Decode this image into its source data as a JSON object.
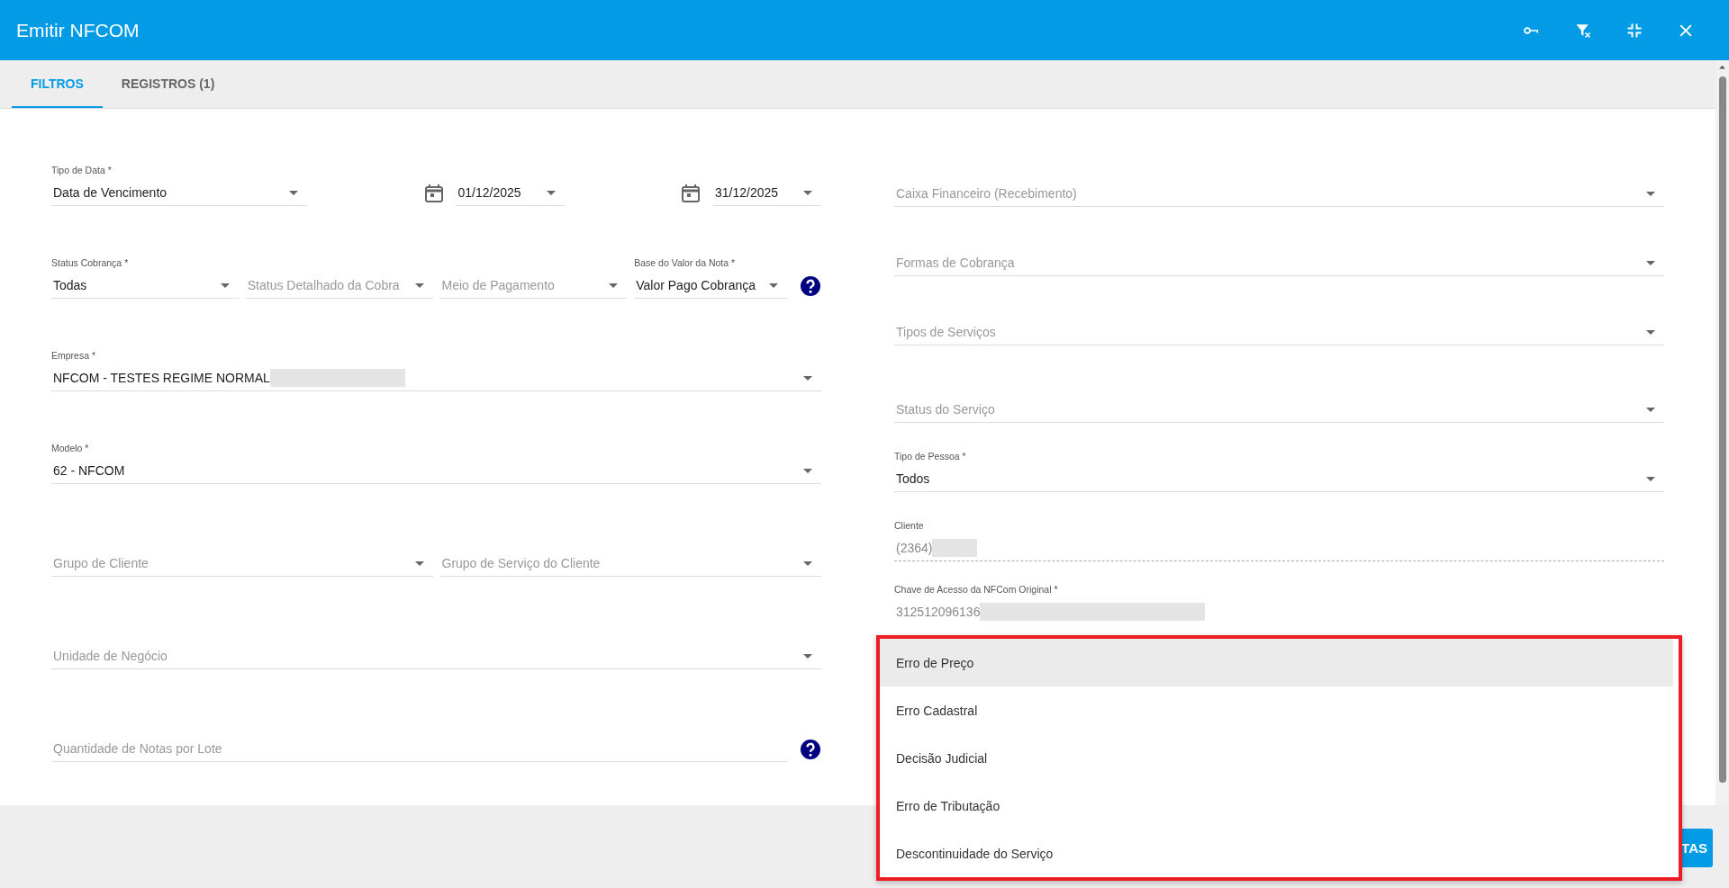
{
  "window": {
    "title": "Emitir NFCOM"
  },
  "tabs": [
    {
      "label": "FILTROS",
      "selected": true
    },
    {
      "label": "REGISTROS (1)",
      "selected": false
    }
  ],
  "left_rows": [
    [
      {
        "kind": "select",
        "label": "Tipo de Data *",
        "value": "Data de Vencimento"
      },
      {
        "kind": "date",
        "value": "01/12/2025"
      },
      {
        "kind": "date",
        "value": "31/12/2025"
      }
    ],
    [
      {
        "kind": "select",
        "label": "Status Cobrança *",
        "value": "Todas"
      },
      {
        "kind": "select",
        "placeholder": "Status Detalhado da Cobra"
      },
      {
        "kind": "select",
        "placeholder": "Meio de Pagamento"
      },
      {
        "kind": "select",
        "label": "Base do Valor da Nota *",
        "value": "Valor Pago Cobrança",
        "help": true
      }
    ],
    [
      {
        "kind": "select",
        "label": "Empresa *",
        "value": "NFCOM - TESTES REGIME NORMAL",
        "redacted": true
      }
    ],
    [
      {
        "kind": "select",
        "label": "Modelo *",
        "value": "62 - NFCOM"
      }
    ],
    [
      {
        "kind": "select",
        "placeholder": "Grupo de Cliente"
      },
      {
        "kind": "select",
        "placeholder": "Grupo de Serviço do Cliente"
      }
    ],
    [
      {
        "kind": "select",
        "placeholder": "Unidade de Negócio"
      }
    ],
    [
      {
        "kind": "input",
        "placeholder": "Quantidade de Notas por Lote",
        "help": true
      }
    ]
  ],
  "right_rows": [
    [
      {
        "kind": "select",
        "placeholder": "Caixa Financeiro (Recebimento)"
      }
    ],
    [
      {
        "kind": "select",
        "placeholder": "Formas de Cobrança"
      }
    ],
    [
      {
        "kind": "select",
        "placeholder": "Tipos de Serviços"
      }
    ],
    [
      {
        "kind": "select",
        "placeholder": "Status do Serviço"
      }
    ],
    [
      {
        "kind": "select",
        "label": "Tipo de Pessoa *",
        "value": "Todos"
      }
    ],
    [
      {
        "kind": "lookup",
        "label": "Cliente",
        "value": "(2364)",
        "readonly": true,
        "redacted": true
      }
    ],
    [
      {
        "kind": "text",
        "label": "Chave de Acesso da NFCom Original *",
        "value": "312512096136",
        "readonly": true,
        "redacted": true
      }
    ]
  ],
  "dropdown": {
    "options": [
      {
        "label": "Erro de Preço",
        "highlighted": true
      },
      {
        "label": "Erro Cadastral",
        "highlighted": false
      },
      {
        "label": "Decisão Judicial",
        "highlighted": false
      },
      {
        "label": "Erro de Tributação",
        "highlighted": false
      },
      {
        "label": "Descontinuidade do Serviço",
        "highlighted": false
      }
    ]
  },
  "footer": {
    "button": "TAS"
  }
}
